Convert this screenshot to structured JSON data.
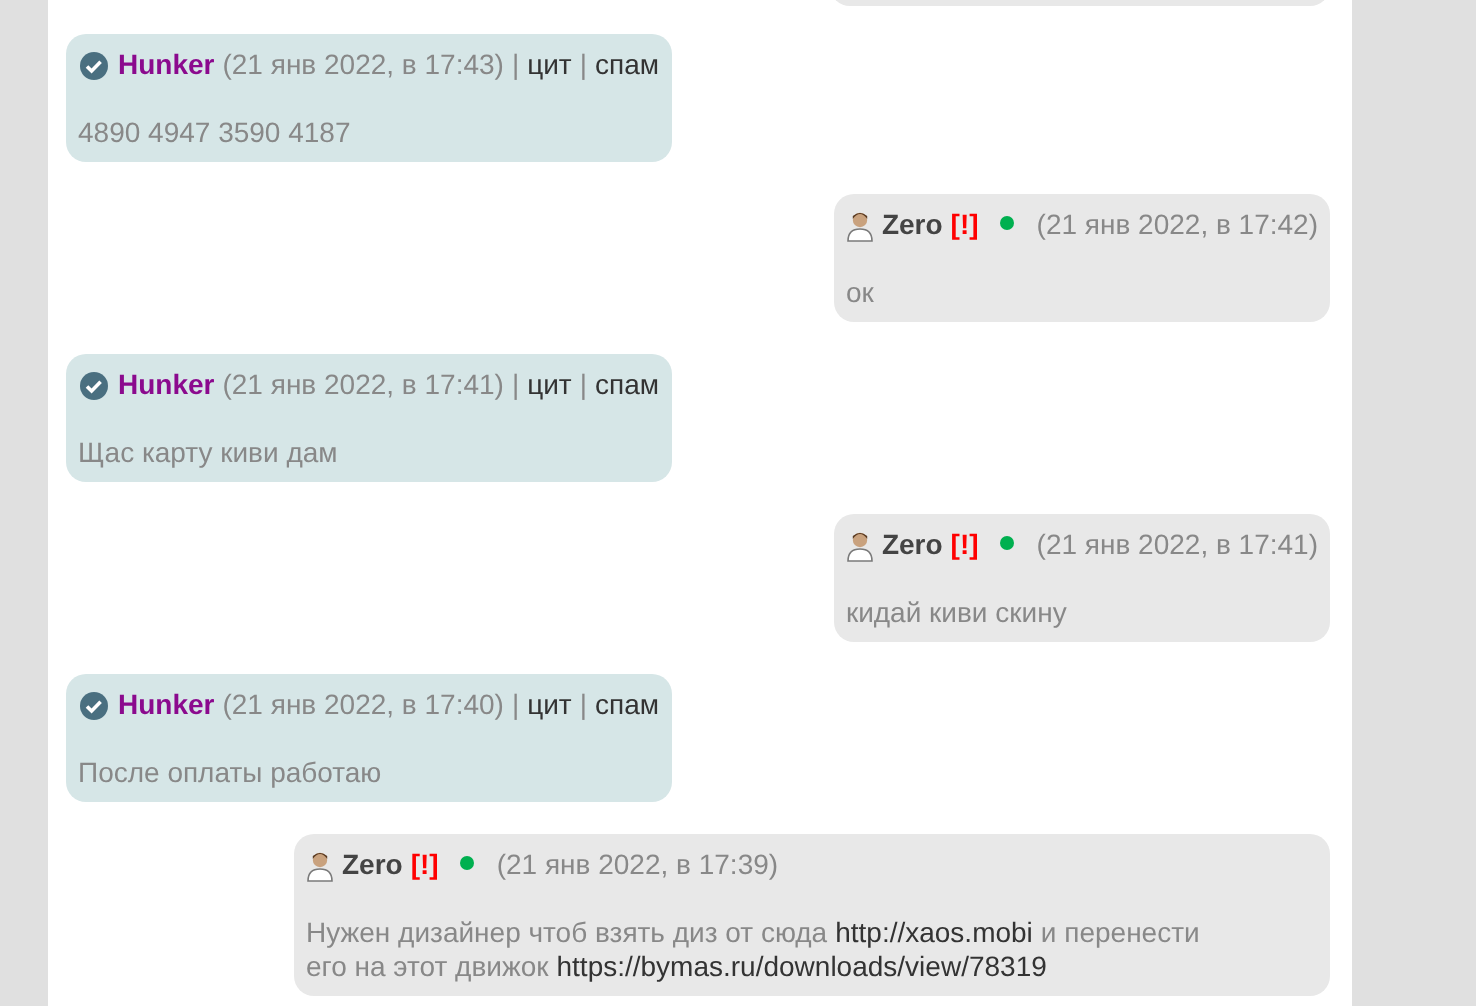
{
  "messages": [
    {
      "kind": "incoming",
      "author": "Hunker",
      "time": "(21 янв 2022, в 17:43)",
      "actions": [
        {
          "separator": "|",
          "label": "цит"
        },
        {
          "separator": "|",
          "label": "спам"
        }
      ],
      "lines": [
        [
          {
            "text": "4890 4947 3590 4187",
            "link": false
          }
        ]
      ]
    },
    {
      "kind": "outgoing",
      "author": "Zero",
      "flag": "[!]",
      "online": true,
      "time": "(21 янв 2022, в 17:42)",
      "lines": [
        [
          {
            "text": "ок",
            "link": false
          }
        ]
      ]
    },
    {
      "kind": "incoming",
      "author": "Hunker",
      "time": "(21 янв 2022, в 17:41)",
      "actions": [
        {
          "separator": "|",
          "label": "цит"
        },
        {
          "separator": "|",
          "label": "спам"
        }
      ],
      "lines": [
        [
          {
            "text": "Щас карту киви дам",
            "link": false
          }
        ]
      ]
    },
    {
      "kind": "outgoing",
      "author": "Zero",
      "flag": "[!]",
      "online": true,
      "time": "(21 янв 2022, в 17:41)",
      "lines": [
        [
          {
            "text": "кидай киви скину",
            "link": false
          }
        ]
      ]
    },
    {
      "kind": "incoming",
      "author": "Hunker",
      "time": "(21 янв 2022, в 17:40)",
      "actions": [
        {
          "separator": "|",
          "label": "цит"
        },
        {
          "separator": "|",
          "label": "спам"
        }
      ],
      "lines": [
        [
          {
            "text": "После оплаты работаю",
            "link": false
          }
        ]
      ]
    },
    {
      "kind": "outgoing",
      "author": "Zero",
      "flag": "[!]",
      "online": true,
      "time": "(21 янв 2022, в 17:39)",
      "lines": [
        [
          {
            "text": "Нужен дизайнер чтоб взять диз от сюда",
            "link": false
          },
          {
            "text": "http://xaos.mobi",
            "link": true
          },
          {
            "text": "и перенести",
            "link": false
          }
        ],
        [
          {
            "text": "его на этот движок",
            "link": false
          },
          {
            "text": "https://bymas.ru/downloads/view/78319",
            "link": true
          }
        ]
      ]
    }
  ]
}
